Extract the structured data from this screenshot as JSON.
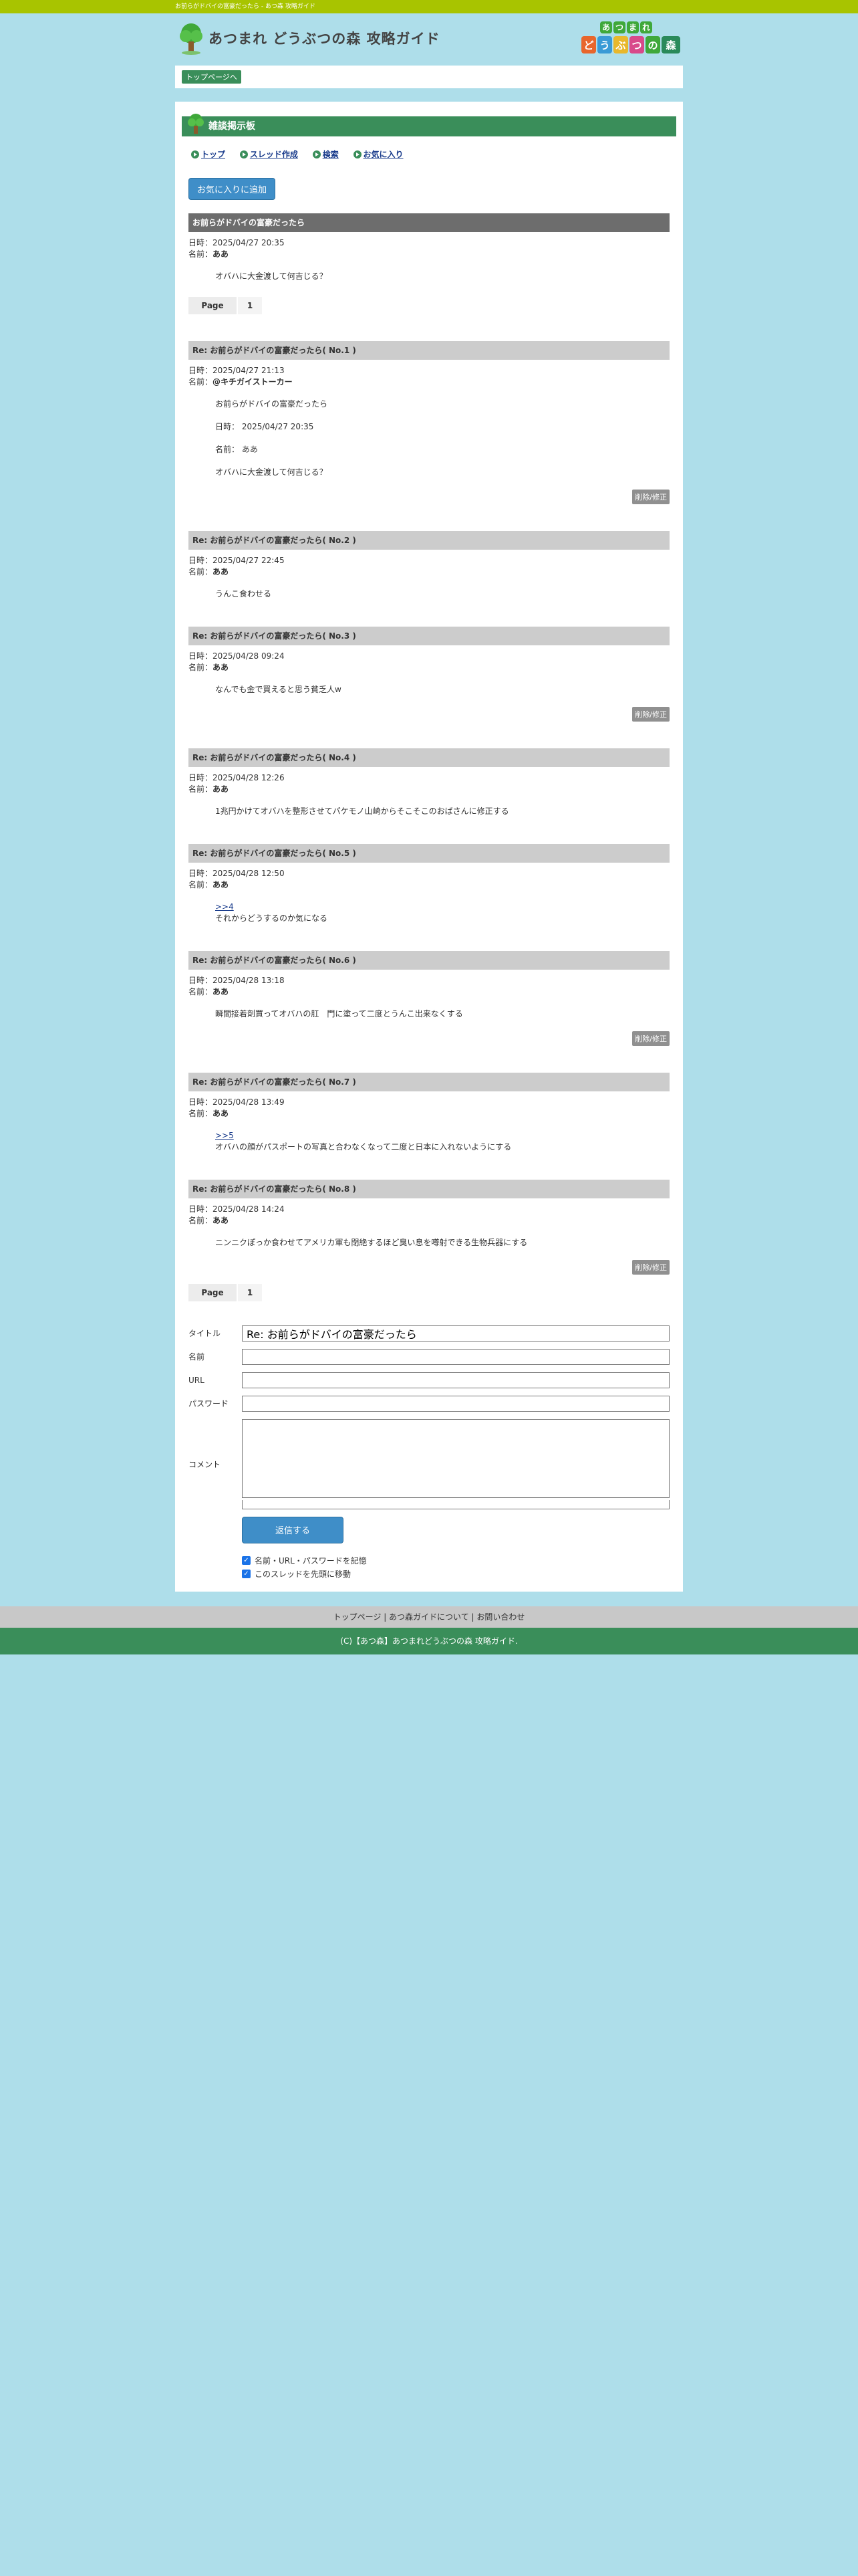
{
  "topbar": {
    "text": "お前らがドバイの富豪だったら - あつ森 攻略ガイド"
  },
  "header": {
    "site_name": "あつまれ どうぶつの森 攻略ガイド",
    "corner_logo": [
      "あ",
      "つ",
      "ま",
      "れ",
      "ど",
      "う",
      "ぶ",
      "つ",
      "の",
      "森"
    ]
  },
  "breadcrumb": {
    "label": "トップページへ"
  },
  "board": {
    "title": "雑談掲示板"
  },
  "nav": {
    "top": "トップ",
    "create": "スレッド作成",
    "search": "検索",
    "favorites": "お気に入り"
  },
  "fav_button": "お気に入りに追加",
  "labels": {
    "date": "日時：",
    "name": "名前：",
    "page": "Page",
    "edit": "削除/修正"
  },
  "parent": {
    "title": "お前らがドバイの富豪だったら",
    "date": "2025/04/27 20:35",
    "name": "ああ",
    "body": "オバハに大金渡して何吉じる？"
  },
  "pager": {
    "page": "1"
  },
  "replies": [
    {
      "title": "Re: お前らがドバイの富豪だったら( No.1 )",
      "date": "2025/04/27 21:13",
      "name": "@キチガイストーカー",
      "lines": [
        "お前らがドバイの富豪だったら",
        "日時： 2025/04/27 20:35",
        "名前： ああ",
        "オバハに大金渡して何吉じる？"
      ],
      "edit": true
    },
    {
      "title": "Re: お前らがドバイの富豪だったら( No.2 )",
      "date": "2025/04/27 22:45",
      "name": "ああ",
      "lines": [
        "うんこ食わせる"
      ],
      "edit": false
    },
    {
      "title": "Re: お前らがドバイの富豪だったら( No.3 )",
      "date": "2025/04/28 09:24",
      "name": "ああ",
      "lines": [
        "なんでも金で買えると思う貧乏人w"
      ],
      "edit": true
    },
    {
      "title": "Re: お前らがドバイの富豪だったら( No.4 )",
      "date": "2025/04/28 12:26",
      "name": "ああ",
      "lines": [
        "1兆円かけてオバハを整形させてパケモノ山崎からそこそこのおばさんに修正する"
      ],
      "edit": false
    },
    {
      "title": "Re: お前らがドバイの富豪だったら( No.5 )",
      "date": "2025/04/28 12:50",
      "name": "ああ",
      "anchor": ">>4",
      "lines": [
        "それからどうするのか気になる"
      ],
      "edit": false
    },
    {
      "title": "Re: お前らがドバイの富豪だったら( No.6 )",
      "date": "2025/04/28 13:18",
      "name": "ああ",
      "lines": [
        "瞬間接着剤買ってオバハの肛　門に塗って二度とうんこ出来なくする"
      ],
      "edit": true
    },
    {
      "title": "Re: お前らがドバイの富豪だったら( No.7 )",
      "date": "2025/04/28 13:49",
      "name": "ああ",
      "anchor": ">>5",
      "lines": [
        "オバハの顔がパスポートの写真と合わなくなって二度と日本に入れないようにする"
      ],
      "edit": false
    },
    {
      "title": "Re: お前らがドバイの富豪だったら( No.8 )",
      "date": "2025/04/28 14:24",
      "name": "ああ",
      "lines": [
        "ニンニクぽっか食わせてアメリカ軍も閉絶するほど臭い息を噂射できる生物兵器にする"
      ],
      "edit": true
    }
  ],
  "form": {
    "title_label": "タイトル",
    "title_value": "Re: お前らがドバイの富豪だったら",
    "name_label": "名前",
    "url_label": "URL",
    "password_label": "パスワード",
    "comment_label": "コメント",
    "submit": "返信する",
    "remember": "名前・URL・パスワードを記憶",
    "move_top": "このスレッドを先頭に移動"
  },
  "footer": {
    "links": "トップページ | あつ森ガイドについて | お問い合わせ",
    "copyright": "(C)【あつ森】あつまれどうぶつの森 攻略ガイド."
  },
  "colors": {
    "green": "#3a8e5a",
    "lime": "#a8c400",
    "sky": "#aedeea",
    "blue_btn": "#3f8ec8"
  }
}
